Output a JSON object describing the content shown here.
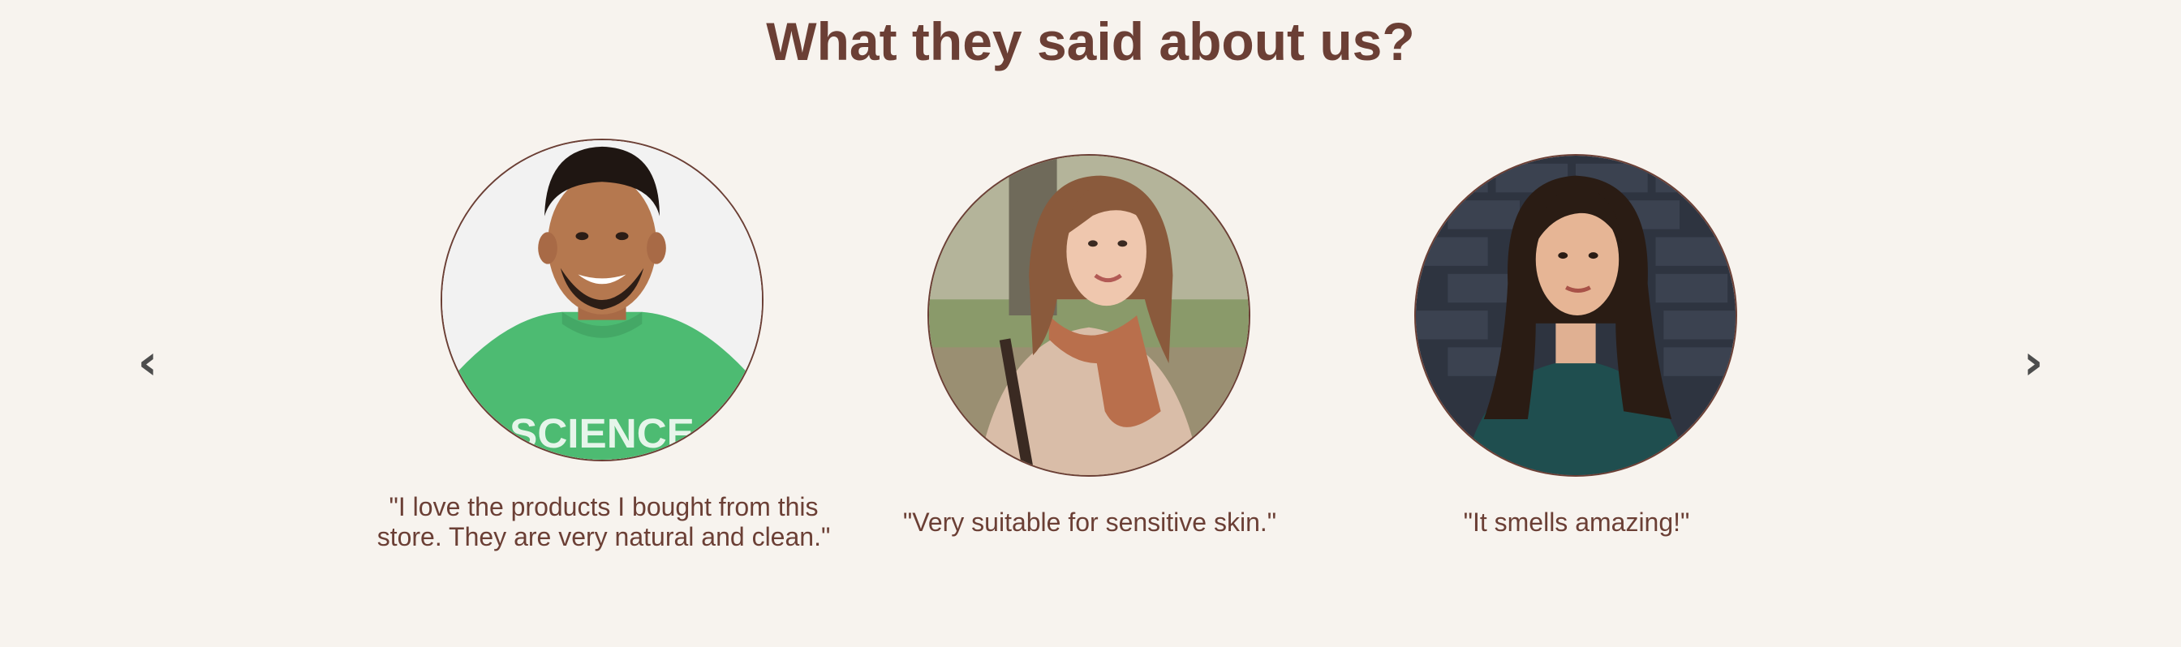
{
  "section": {
    "title": "What they said about us?"
  },
  "carousel": {
    "prev_icon": "chevron-left-icon",
    "next_icon": "chevron-right-icon",
    "prev_glyph": "‹",
    "next_glyph": "›"
  },
  "testimonials": [
    {
      "quote": "\"I love the products I bought from this store. They are very natural and clean.\""
    },
    {
      "quote": "\"Very suitable for sensitive skin.\""
    },
    {
      "quote": "\"It smells amazing!\""
    }
  ],
  "colors": {
    "background": "#f7f3ee",
    "accent": "#6b3f35",
    "arrow": "#4d4d4d"
  }
}
